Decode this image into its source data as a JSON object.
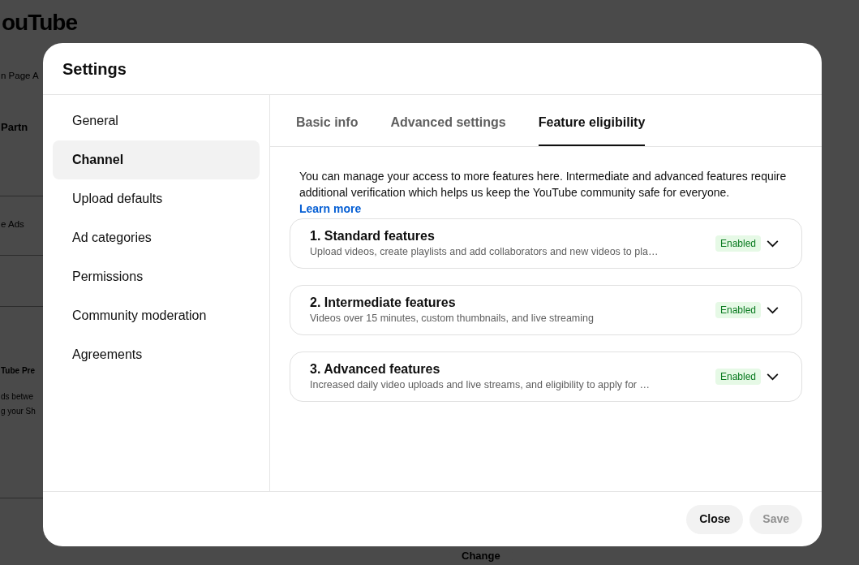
{
  "background": {
    "brand": "ouTube",
    "texts": [
      {
        "kind": "plain",
        "text": "n Page A"
      },
      {
        "kind": "heading",
        "text": "Partn"
      },
      {
        "kind": "plain",
        "text": "e Ads"
      },
      {
        "kind": "small-bold",
        "text": "Tube Pre"
      },
      {
        "kind": "small",
        "text": "ds betwe"
      },
      {
        "kind": "small",
        "text": "g your Sh"
      }
    ],
    "button": "Change"
  },
  "dialog": {
    "title": "Settings",
    "sidebar": {
      "items": [
        {
          "label": "General",
          "selected": false
        },
        {
          "label": "Channel",
          "selected": true
        },
        {
          "label": "Upload defaults",
          "selected": false
        },
        {
          "label": "Ad categories",
          "selected": false
        },
        {
          "label": "Permissions",
          "selected": false
        },
        {
          "label": "Community moderation",
          "selected": false
        },
        {
          "label": "Agreements",
          "selected": false
        }
      ]
    },
    "tabs": [
      {
        "label": "Basic info",
        "selected": false
      },
      {
        "label": "Advanced settings",
        "selected": false
      },
      {
        "label": "Feature eligibility",
        "selected": true
      }
    ],
    "intro": "You can manage your access to more features here. Intermediate and advanced features require additional verification which helps us keep the YouTube community safe for everyone.",
    "learn_more": "Learn more",
    "features": [
      {
        "title": "1. Standard features",
        "description": "Upload videos, create playlists and add collaborators and new videos to pla…",
        "status": "Enabled",
        "expanded": false
      },
      {
        "title": "2. Intermediate features",
        "description": "Videos over 15 minutes, custom thumbnails, and live streaming",
        "status": "Enabled",
        "expanded": false
      },
      {
        "title": "3. Advanced features",
        "description": "Increased daily video uploads and live streams, and eligibility to apply for …",
        "status": "Enabled",
        "expanded": false
      }
    ],
    "buttons": [
      {
        "label": "Close",
        "disabled": false
      },
      {
        "label": "Save",
        "disabled": true
      }
    ]
  }
}
